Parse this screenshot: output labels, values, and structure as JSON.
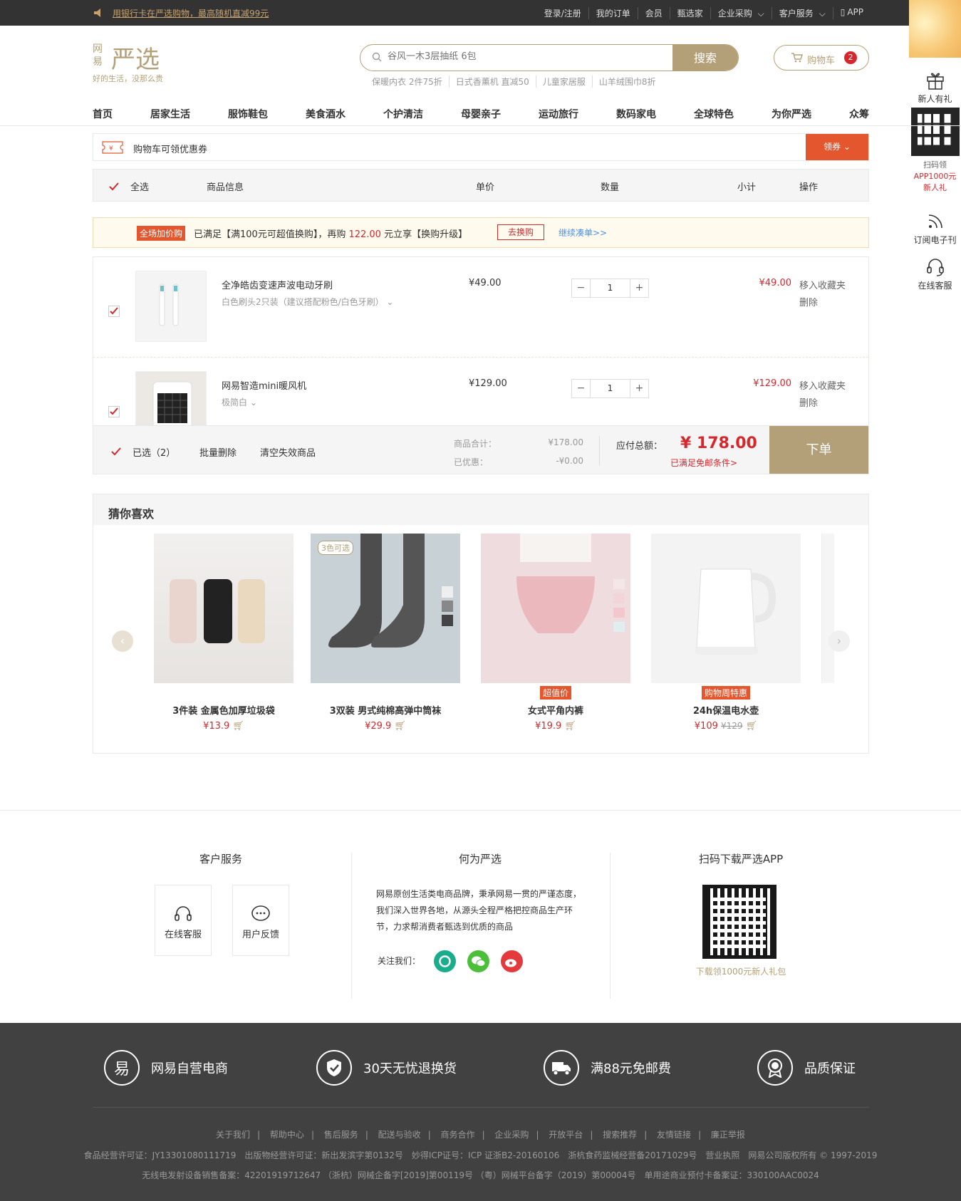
{
  "topbar": {
    "promo": "用银行卡在严选购物，最高随机直减99元",
    "links": [
      "登录/注册",
      "我的订单",
      "会员",
      "甄选家",
      "企业采购",
      "客户服务",
      "APP"
    ]
  },
  "logo": {
    "brand": "严选",
    "sub": "网易",
    "slogan": "好的生活，没那么贵"
  },
  "search": {
    "placeholder": "谷风一木3层抽纸 6包",
    "button": "搜索",
    "hotwords": [
      "保暖内衣 2件75折",
      "日式香薰机 直减50",
      "儿童家居服",
      "山羊绒围巾8折"
    ]
  },
  "cart": {
    "label": "购物车",
    "count": "2"
  },
  "nav": [
    "首页",
    "居家生活",
    "服饰鞋包",
    "美食酒水",
    "个护清洁",
    "母婴亲子",
    "运动旅行",
    "数码家电",
    "全球特色",
    "为你严选",
    "众筹"
  ],
  "sidebar": {
    "gift": "新人有礼",
    "qr_line1": "扫码领",
    "qr_line2": "APP1000元",
    "qr_line3": "新人礼",
    "subscribe": "订阅电子刊",
    "service": "在线客服"
  },
  "coupon": {
    "text": "购物车可领优惠券",
    "button": "领券"
  },
  "table_header": {
    "select_all": "全选",
    "info": "商品信息",
    "price": "单价",
    "qty": "数量",
    "subtotal": "小计",
    "op": "操作"
  },
  "promo_bar": {
    "tag": "全场加价购",
    "text1": "已满足【满100元可超值换购】，再购",
    "amount": "122.00",
    "text2": "元立享【换购升级】",
    "swap": "去换购",
    "more": "继续凑单>>"
  },
  "items": [
    {
      "name": "全净皓齿变速声波电动牙刷",
      "spec": "白色刷头2只装（建议搭配粉色/白色牙刷）",
      "price": "¥49.00",
      "qty": "1",
      "subtotal": "¥49.00",
      "op1": "移入收藏夹",
      "op2": "删除"
    },
    {
      "name": "网易智造mini暖风机",
      "spec": "极简白",
      "price": "¥129.00",
      "qty": "1",
      "subtotal": "¥129.00",
      "op1": "移入收藏夹",
      "op2": "删除"
    }
  ],
  "summary": {
    "selected": "已选（2）",
    "batch_delete": "批量删除",
    "clear": "清空失效商品",
    "goods_total_label": "商品合计：",
    "goods_total": "¥178.00",
    "discount_label": "已优惠：",
    "discount": "-¥0.00",
    "pay_label": "应付总额：",
    "pay_total": "¥ 178.00",
    "free_ship": "已满足免邮条件>",
    "order_button": "下单"
  },
  "guess": {
    "title": "猜你喜欢",
    "products": [
      {
        "name": "3件装 金属色加厚垃圾袋",
        "price": "¥13.9",
        "tag": "",
        "badge": "",
        "old_price": ""
      },
      {
        "name": "3双装 男式纯棉高弹中筒袜",
        "price": "¥29.9",
        "tag": "",
        "badge": "3色可选",
        "old_price": ""
      },
      {
        "name": "女式平角内裤",
        "price": "¥19.9",
        "tag": "超值价",
        "badge": "",
        "old_price": ""
      },
      {
        "name": "24h保温电水壶",
        "price": "¥109",
        "tag": "购物周特惠",
        "badge": "",
        "old_price": "¥129"
      }
    ]
  },
  "footer": {
    "service_title": "客户服务",
    "online": "在线客服",
    "feedback": "用户反馈",
    "about_title": "何为严选",
    "about_text": "网易原创生活类电商品牌，秉承网易一贯的严谨态度，我们深入世界各地，从源头全程严格把控商品生产环节，力求帮消费者甄选到优质的商品",
    "follow": "关注我们：",
    "app_title": "扫码下载严选APP",
    "app_sub": "下载领1000元新人礼包",
    "features": [
      "网易自营电商",
      "30天无忧退换货",
      "满88元免邮费",
      "品质保证"
    ],
    "links": [
      "关于我们",
      "帮助中心",
      "售后服务",
      "配送与验收",
      "商务合作",
      "企业采购",
      "开放平台",
      "搜索推荐",
      "友情链接",
      "廉正举报"
    ],
    "license1": "食品经营许可证：JY13301080111719　出版物经营许可证：新出发滨字第0132号　妙得ICP证号：ICP 证浙B2-20160106　浙杭食药监械经营备20171029号　营业执照　网易公司版权所有 © 1997-2019",
    "license2": "无线电发射设备销售备案：42201919712647 （浙杭）网械企备字[2019]第00119号 （粤）网械平台备字（2019）第00004号　单用途商业预付卡备案证：330100AAC0024"
  },
  "colors": {
    "gold": "#b4a078",
    "red": "#d4282d",
    "orange": "#e4572e",
    "dark": "#414141"
  }
}
